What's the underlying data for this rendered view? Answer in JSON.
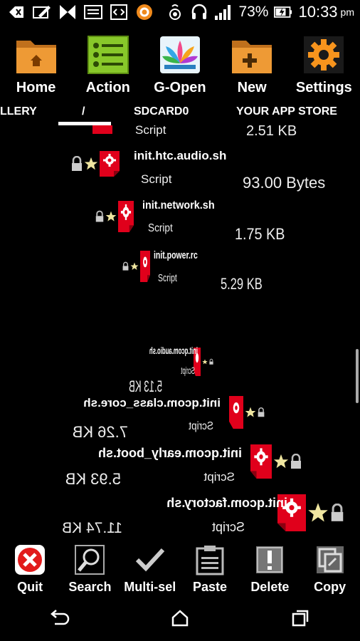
{
  "status_bar": {
    "battery": "73%",
    "time": "10:33",
    "ampm": "pm"
  },
  "toolbar": [
    {
      "label": "Home",
      "icon": "home-folder-icon"
    },
    {
      "label": "Action",
      "icon": "checklist-icon"
    },
    {
      "label": "G-Open",
      "icon": "lotus-icon"
    },
    {
      "label": "New",
      "icon": "new-folder-icon"
    },
    {
      "label": "Settings",
      "icon": "gear-icon"
    }
  ],
  "tabs": {
    "gallery": "LLERY",
    "root": "/",
    "sdcard": "SDCARD0",
    "app_store": "YOUR APP STORE"
  },
  "files": [
    {
      "name": "",
      "type": "Script",
      "size": "2.51 KB"
    },
    {
      "name": "init.htc.audio.sh",
      "type": "Script",
      "size": "93.00 Bytes"
    },
    {
      "name": "init.network.sh",
      "type": "Script",
      "size": "1.75 KB"
    },
    {
      "name": "init.power.rc",
      "type": "Script",
      "size": "5.29 KB"
    },
    {
      "name": "init.qcom.audio.sh",
      "type": "Script",
      "size": "5.13 KB"
    },
    {
      "name": "init.qcom.class_core.sh",
      "type": "Script",
      "size": "7.26 KB"
    },
    {
      "name": "init.qcom.early_boot.sh",
      "type": "Script",
      "size": "5.93 KB"
    },
    {
      "name": "init.qcom.factory.sh",
      "type": "Script",
      "size": "11.74 KB"
    }
  ],
  "actions": [
    {
      "label": "Quit",
      "icon": "quit-icon"
    },
    {
      "label": "Search",
      "icon": "search-icon"
    },
    {
      "label": "Multi-sel",
      "icon": "checkmark-icon"
    },
    {
      "label": "Paste",
      "icon": "clipboard-icon"
    },
    {
      "label": "Delete",
      "icon": "delete-icon"
    },
    {
      "label": "Copy",
      "icon": "copy-icon"
    }
  ],
  "colors": {
    "script_red": "#e0001b",
    "star": "#f0e6a0",
    "folder_orange": "#e8932e"
  }
}
